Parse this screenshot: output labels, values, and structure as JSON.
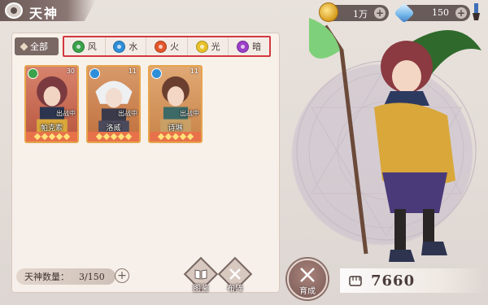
{
  "header": {
    "title": "天神"
  },
  "currencies": [
    {
      "name": "gold",
      "value": "1万"
    },
    {
      "name": "gem",
      "value": "150"
    }
  ],
  "filters": {
    "all_label": "全部",
    "elements": [
      {
        "label": "风",
        "color": "#3aa24a"
      },
      {
        "label": "水",
        "color": "#2f8ed8"
      },
      {
        "label": "火",
        "color": "#e2562b"
      },
      {
        "label": "光",
        "color": "#e8c22a"
      },
      {
        "label": "暗",
        "color": "#9b3fc8"
      }
    ]
  },
  "cards": [
    {
      "name": "帕克索",
      "level": "30",
      "status": "出战中",
      "element_color": "#3aa24a",
      "stars": 5
    },
    {
      "name": "洛威",
      "level": "11",
      "status": "出战中",
      "element_color": "#2f8ed8",
      "stars": 5
    },
    {
      "name": "诗琳",
      "level": "11",
      "status": "出战中",
      "element_color": "#2f8ed8",
      "stars": 5
    }
  ],
  "footer": {
    "count_label": "天神数量：",
    "count_value": "3/150",
    "codex_label": "图鉴",
    "formation_label": "布阵",
    "nurture_label": "育成",
    "power_value": "7660"
  },
  "colors": {
    "highlight_border": "#d4373f",
    "panel": "#f8f2ec",
    "accent": "#7a6864"
  }
}
